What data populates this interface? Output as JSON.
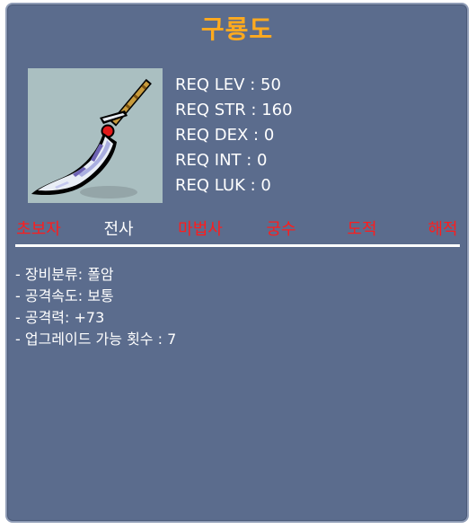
{
  "item": {
    "name": "구룡도",
    "name_color": "#ffaa1e",
    "icon": "polearm-blade-icon"
  },
  "requirements": [
    "REQ LEV : 50",
    "REQ STR : 160",
    "REQ DEX : 0",
    "REQ INT : 0",
    "REQ LUK : 0"
  ],
  "jobs": [
    {
      "label": "초보자",
      "color": "#ff1c1c"
    },
    {
      "label": "전사",
      "color": "#ffffff"
    },
    {
      "label": "마법사",
      "color": "#ff1c1c"
    },
    {
      "label": "궁수",
      "color": "#ff1c1c"
    },
    {
      "label": "도적",
      "color": "#ff1c1c"
    },
    {
      "label": "해적",
      "color": "#ff1c1c"
    }
  ],
  "details": [
    "- 장비분류: 폴암",
    "- 공격속도: 보통",
    "- 공격력: +73",
    "- 업그레이드 가능 횟수 : 7"
  ],
  "colors": {
    "panel": "#5b6c8d",
    "panel_border": "#8e9bb5",
    "icon_bg": "#aabfc1",
    "disallowed_job": "#ff1c1c",
    "allowed_job": "#ffffff"
  }
}
